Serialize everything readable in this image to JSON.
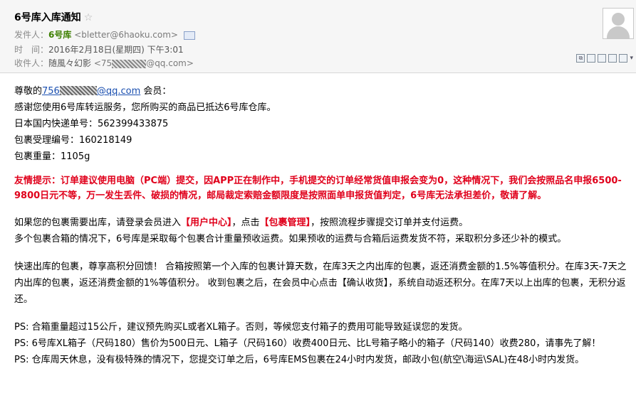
{
  "header": {
    "subject": "6号库入库通知",
    "star_icon": "star-icon",
    "from_label": "发件人：",
    "from_name": "6号库",
    "from_addr": "<bletter@6haoku.com>",
    "time_label": "时　间：",
    "time_value": "2016年2月18日(星期四) 下午3:01",
    "to_label": "收件人：",
    "to_name": "随風々幻影",
    "to_addr_prefix": "<75",
    "to_addr_suffix": "@qq.com>"
  },
  "toolbar": {
    "icons": [
      "restore-icon",
      "window-icon",
      "print-icon",
      "mail-icon",
      "copy-icon",
      "more-icon"
    ]
  },
  "body": {
    "greet_pre": "尊敬的",
    "greet_link_prefix": "756",
    "greet_link_suffix": "@qq.com",
    "greet_post": " 会员：",
    "line1": "感谢您使用6号库转运服务，您所购买的商品已抵达6号库仓库。",
    "line2": "日本国内快递单号：562399433875",
    "line3": "包裹受理编号：160218149",
    "line4": "包裹重量：1105g",
    "tip": "友情提示：订单建议使用电脑（PC端）提交，因APP正在制作中，手机提交的订单经常货值申报会变为0，这种情况下，我们会按照品名申报6500-9800日元不等，万一发生丢件、破损的情况，邮局裁定索赔金额限度是按照面单申报货值判定，6号库无法承担差价，敬请了解。",
    "para1_a": "如果您的包裹需要出库，请登录会员进入",
    "para1_b": "【用户中心】",
    "para1_c": "，点击",
    "para1_d": "【包裹管理】",
    "para1_e": "，按照流程步骤提交订单并支付运费。",
    "para1_line2": "多个包裹合箱的情况下，6号库是采取每个包裹合计重量预收运费。如果预收的运费与合箱后运费发货不符，采取积分多还少补的模式。",
    "para2": "快速出库的包裹，尊享高积分回馈！ 合箱按照第一个入库的包裹计算天数，在库3天之内出库的包裹，返还消费金额的1.5%等值积分。在库3天-7天之内出库的包裹，返还消费金额的1%等值积分。 收到包裹之后，在会员中心点击【确认收货】，系统自动返还积分。在库7天以上出库的包裹，无积分返还。",
    "ps1": "PS: 合箱重量超过15公斤，建议预先购买L或者XL箱子。否则，等候您支付箱子的费用可能导致延误您的发货。",
    "ps2": "PS: 6号库XL箱子（尺码180）售价为500日元、L箱子（尺码160）收费400日元、比L号箱子略小的箱子（尺码140）收费280，请事先了解！",
    "ps3": "PS: 仓库周天休息，没有极特殊的情况下，您提交订单之后，6号库EMS包裹在24小时内发货，邮政小包(航空\\海运\\SAL)在48小时内发货。"
  },
  "colors": {
    "header_bg": "#f6f6f6",
    "tip_red": "#e0001b",
    "sender_green": "#3d7f00",
    "link_blue": "#1a4fb0"
  }
}
